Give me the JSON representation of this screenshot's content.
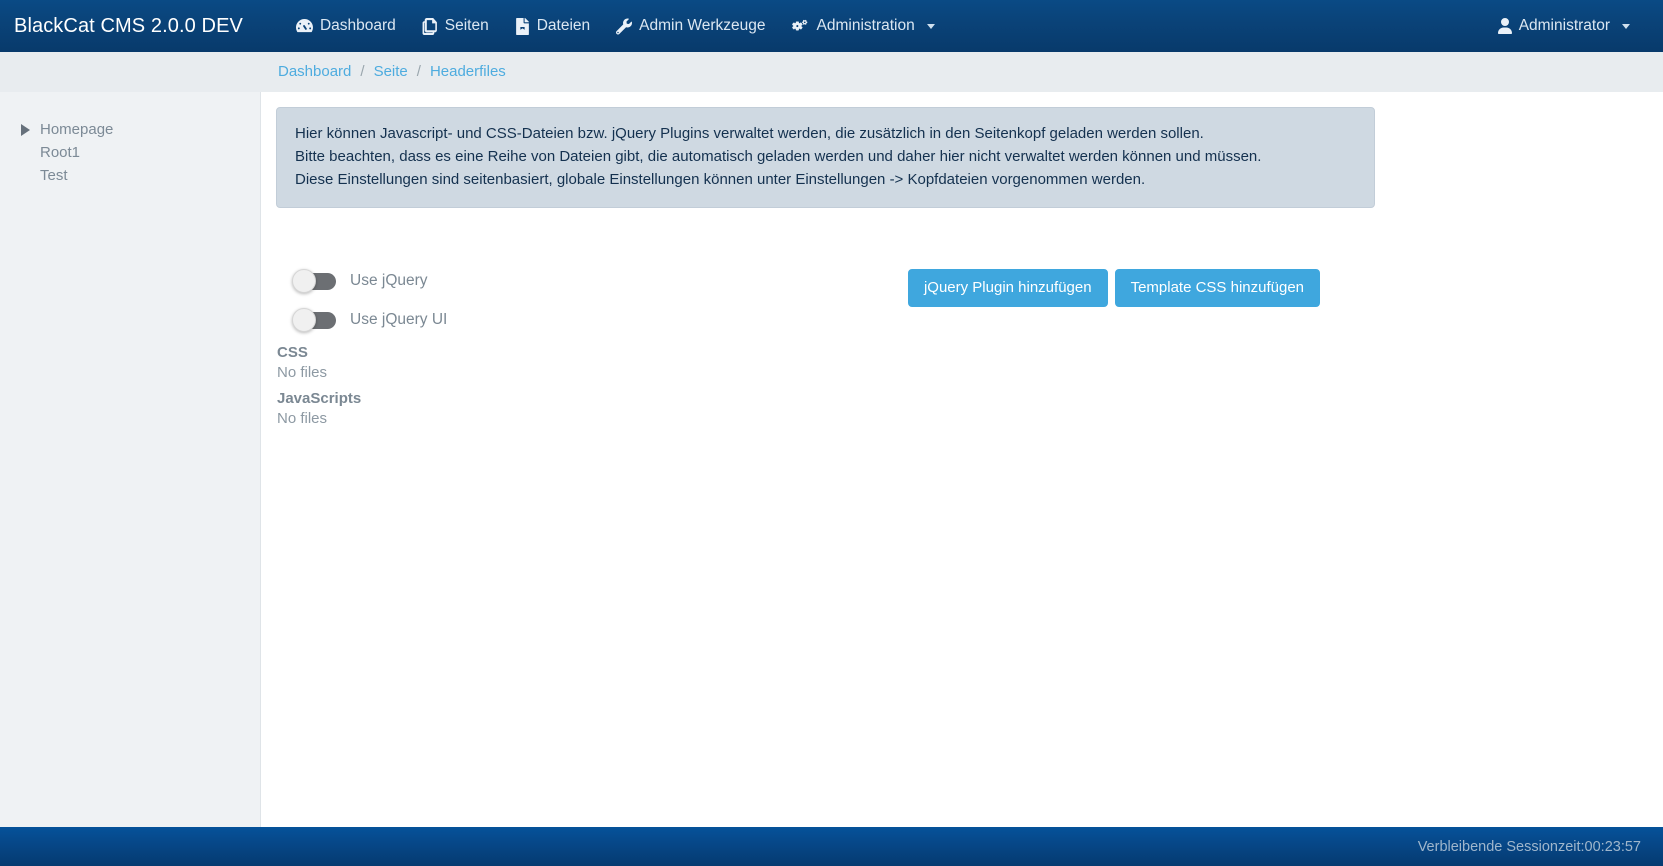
{
  "navbar": {
    "brand": "BlackCat CMS 2.0.0 DEV",
    "items": [
      {
        "label": "Dashboard",
        "icon": "dashboard-icon",
        "caret": false
      },
      {
        "label": "Seiten",
        "icon": "pages-icon",
        "caret": false
      },
      {
        "label": "Dateien",
        "icon": "file-icon",
        "caret": false
      },
      {
        "label": "Admin Werkzeuge",
        "icon": "wrench-icon",
        "caret": false
      },
      {
        "label": "Administration",
        "icon": "cogs-icon",
        "caret": true
      }
    ],
    "user": {
      "label": "Administrator",
      "icon": "user-icon",
      "caret": true
    }
  },
  "breadcrumb": {
    "separator": "/",
    "items": [
      {
        "label": "Dashboard",
        "current": false
      },
      {
        "label": "Seite",
        "current": false
      },
      {
        "label": "Headerfiles",
        "current": true
      }
    ]
  },
  "sidebar": {
    "tree": [
      {
        "label": "Homepage",
        "expandable": true
      },
      {
        "label": "Root1",
        "expandable": false
      },
      {
        "label": "Test",
        "expandable": false
      }
    ]
  },
  "main": {
    "alert": {
      "line1": "Hier können Javascript- und CSS-Dateien bzw. jQuery Plugins verwaltet werden, die zusätzlich in den Seitenkopf geladen werden sollen.",
      "line2": "Bitte beachten, dass es eine Reihe von Dateien gibt, die automatisch geladen werden und daher hier nicht verwaltet werden können und müssen.",
      "line3": "Diese Einstellungen sind seitenbasiert, globale Einstellungen können unter Einstellungen -> Kopfdateien vorgenommen werden."
    },
    "toggles": [
      {
        "label": "Use jQuery",
        "checked": false
      },
      {
        "label": "Use jQuery UI",
        "checked": false
      }
    ],
    "buttons": [
      {
        "label": "jQuery Plugin hinzufügen"
      },
      {
        "label": "Template CSS hinzufügen"
      }
    ],
    "sections": [
      {
        "title": "CSS",
        "empty": "No files"
      },
      {
        "title": "JavaScripts",
        "empty": "No files"
      }
    ]
  },
  "footer": {
    "session": "Verbleibende Sessionzeit:00:23:57"
  },
  "colors": {
    "navbar": "#0a4379",
    "accent": "#3fa7de",
    "link": "#4eacdf",
    "alert_bg": "#cfd9e2",
    "footer": "#05529a"
  }
}
